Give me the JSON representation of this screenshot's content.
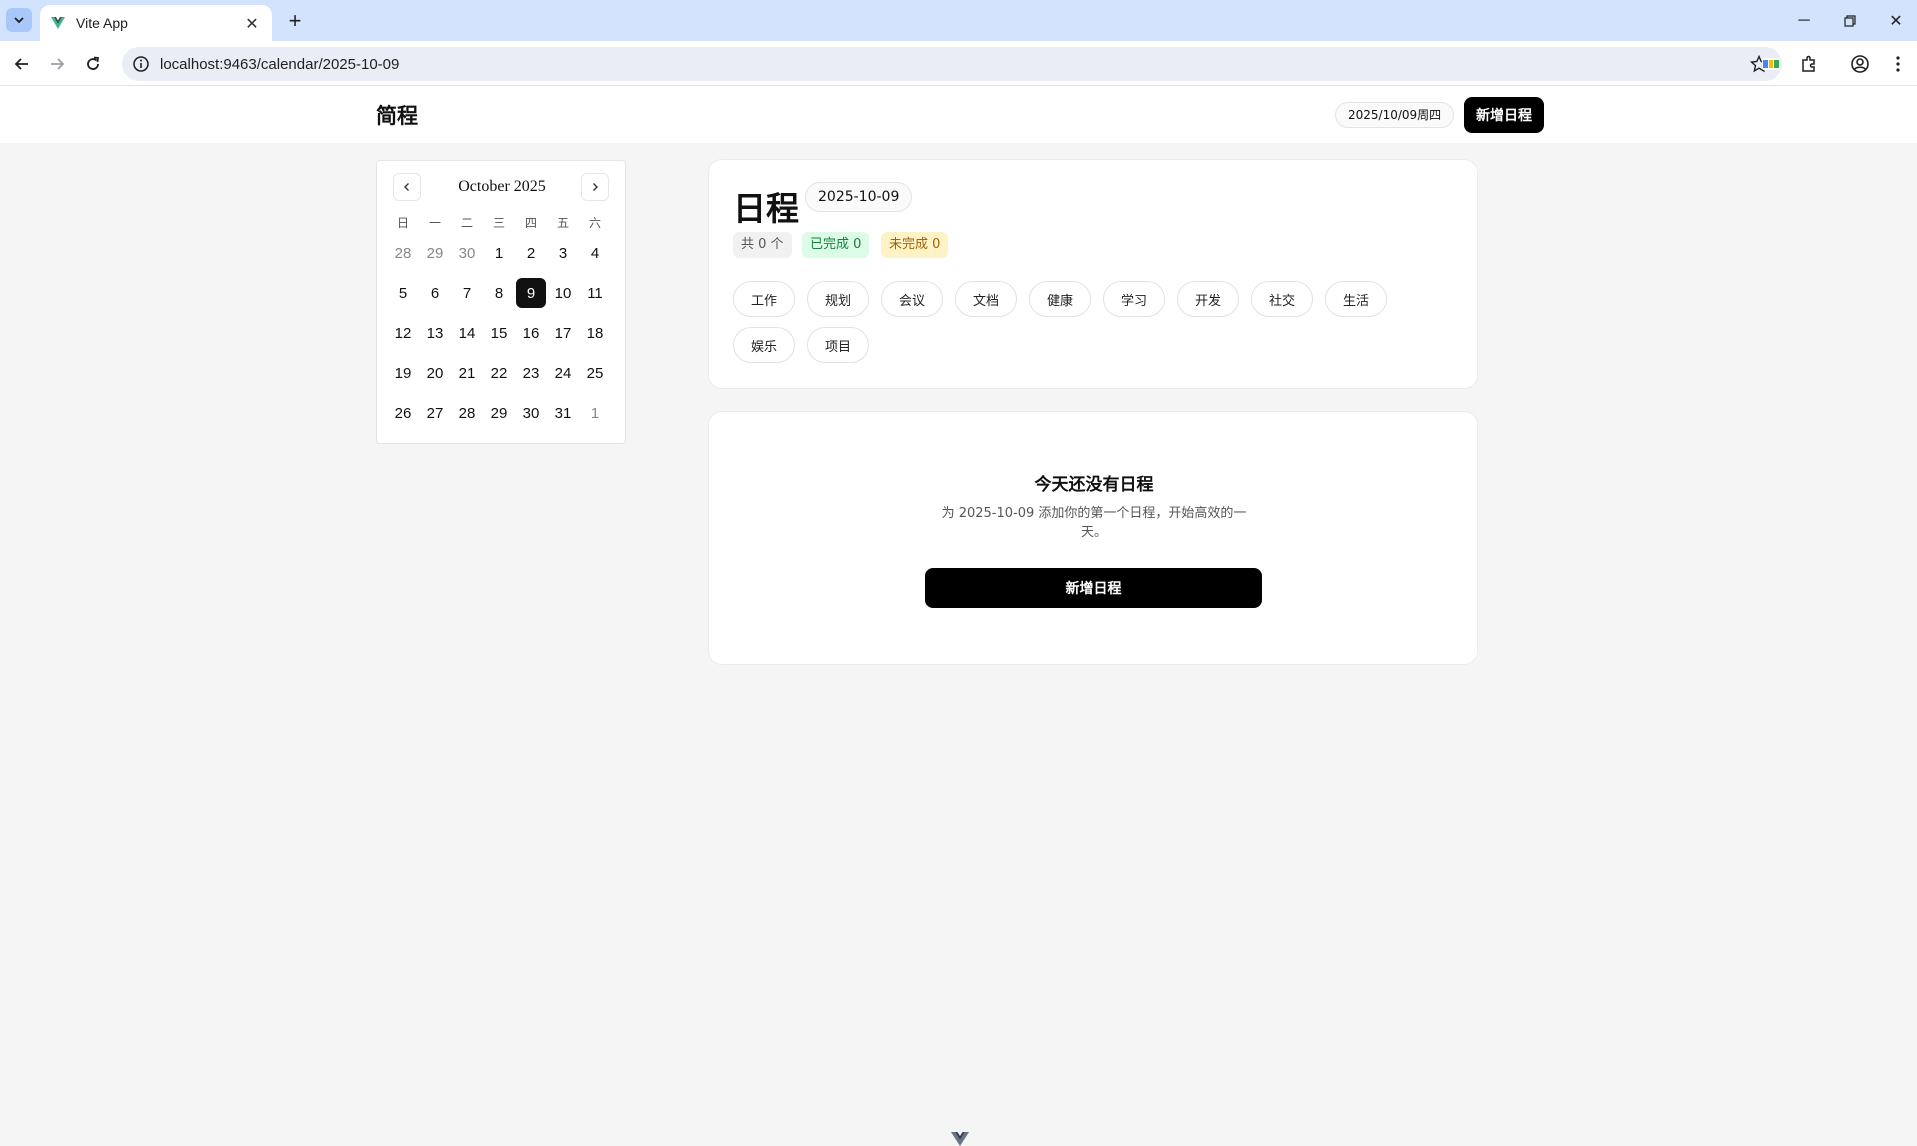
{
  "browser": {
    "tab_title": "Vite App",
    "url": "localhost:9463/calendar/2025-10-09"
  },
  "header": {
    "brand": "简程",
    "current_date": "2025/10/09周四",
    "add_button": "新增日程"
  },
  "calendar": {
    "month_label": "October 2025",
    "weekdays": [
      "日",
      "一",
      "二",
      "三",
      "四",
      "五",
      "六"
    ],
    "days": [
      {
        "d": "28",
        "m": true
      },
      {
        "d": "29",
        "m": true
      },
      {
        "d": "30",
        "m": true
      },
      {
        "d": "1"
      },
      {
        "d": "2"
      },
      {
        "d": "3"
      },
      {
        "d": "4"
      },
      {
        "d": "5"
      },
      {
        "d": "6"
      },
      {
        "d": "7"
      },
      {
        "d": "8"
      },
      {
        "d": "9",
        "s": true
      },
      {
        "d": "10"
      },
      {
        "d": "11"
      },
      {
        "d": "12"
      },
      {
        "d": "13"
      },
      {
        "d": "14"
      },
      {
        "d": "15"
      },
      {
        "d": "16"
      },
      {
        "d": "17"
      },
      {
        "d": "18"
      },
      {
        "d": "19"
      },
      {
        "d": "20"
      },
      {
        "d": "21"
      },
      {
        "d": "22"
      },
      {
        "d": "23"
      },
      {
        "d": "24"
      },
      {
        "d": "25"
      },
      {
        "d": "26"
      },
      {
        "d": "27"
      },
      {
        "d": "28"
      },
      {
        "d": "29"
      },
      {
        "d": "30"
      },
      {
        "d": "31"
      },
      {
        "d": "1",
        "m": true
      }
    ]
  },
  "schedule": {
    "title": "日程",
    "date": "2025-10-09",
    "stats": {
      "total": "共 0 个",
      "done": "已完成 0",
      "todo": "未完成 0"
    },
    "tags": [
      "工作",
      "规划",
      "会议",
      "文档",
      "健康",
      "学习",
      "开发",
      "社交",
      "生活",
      "娱乐",
      "项目"
    ]
  },
  "empty_state": {
    "title": "今天还没有日程",
    "description": "为 2025-10-09 添加你的第一个日程，开始高效的一天。",
    "button": "新增日程"
  }
}
